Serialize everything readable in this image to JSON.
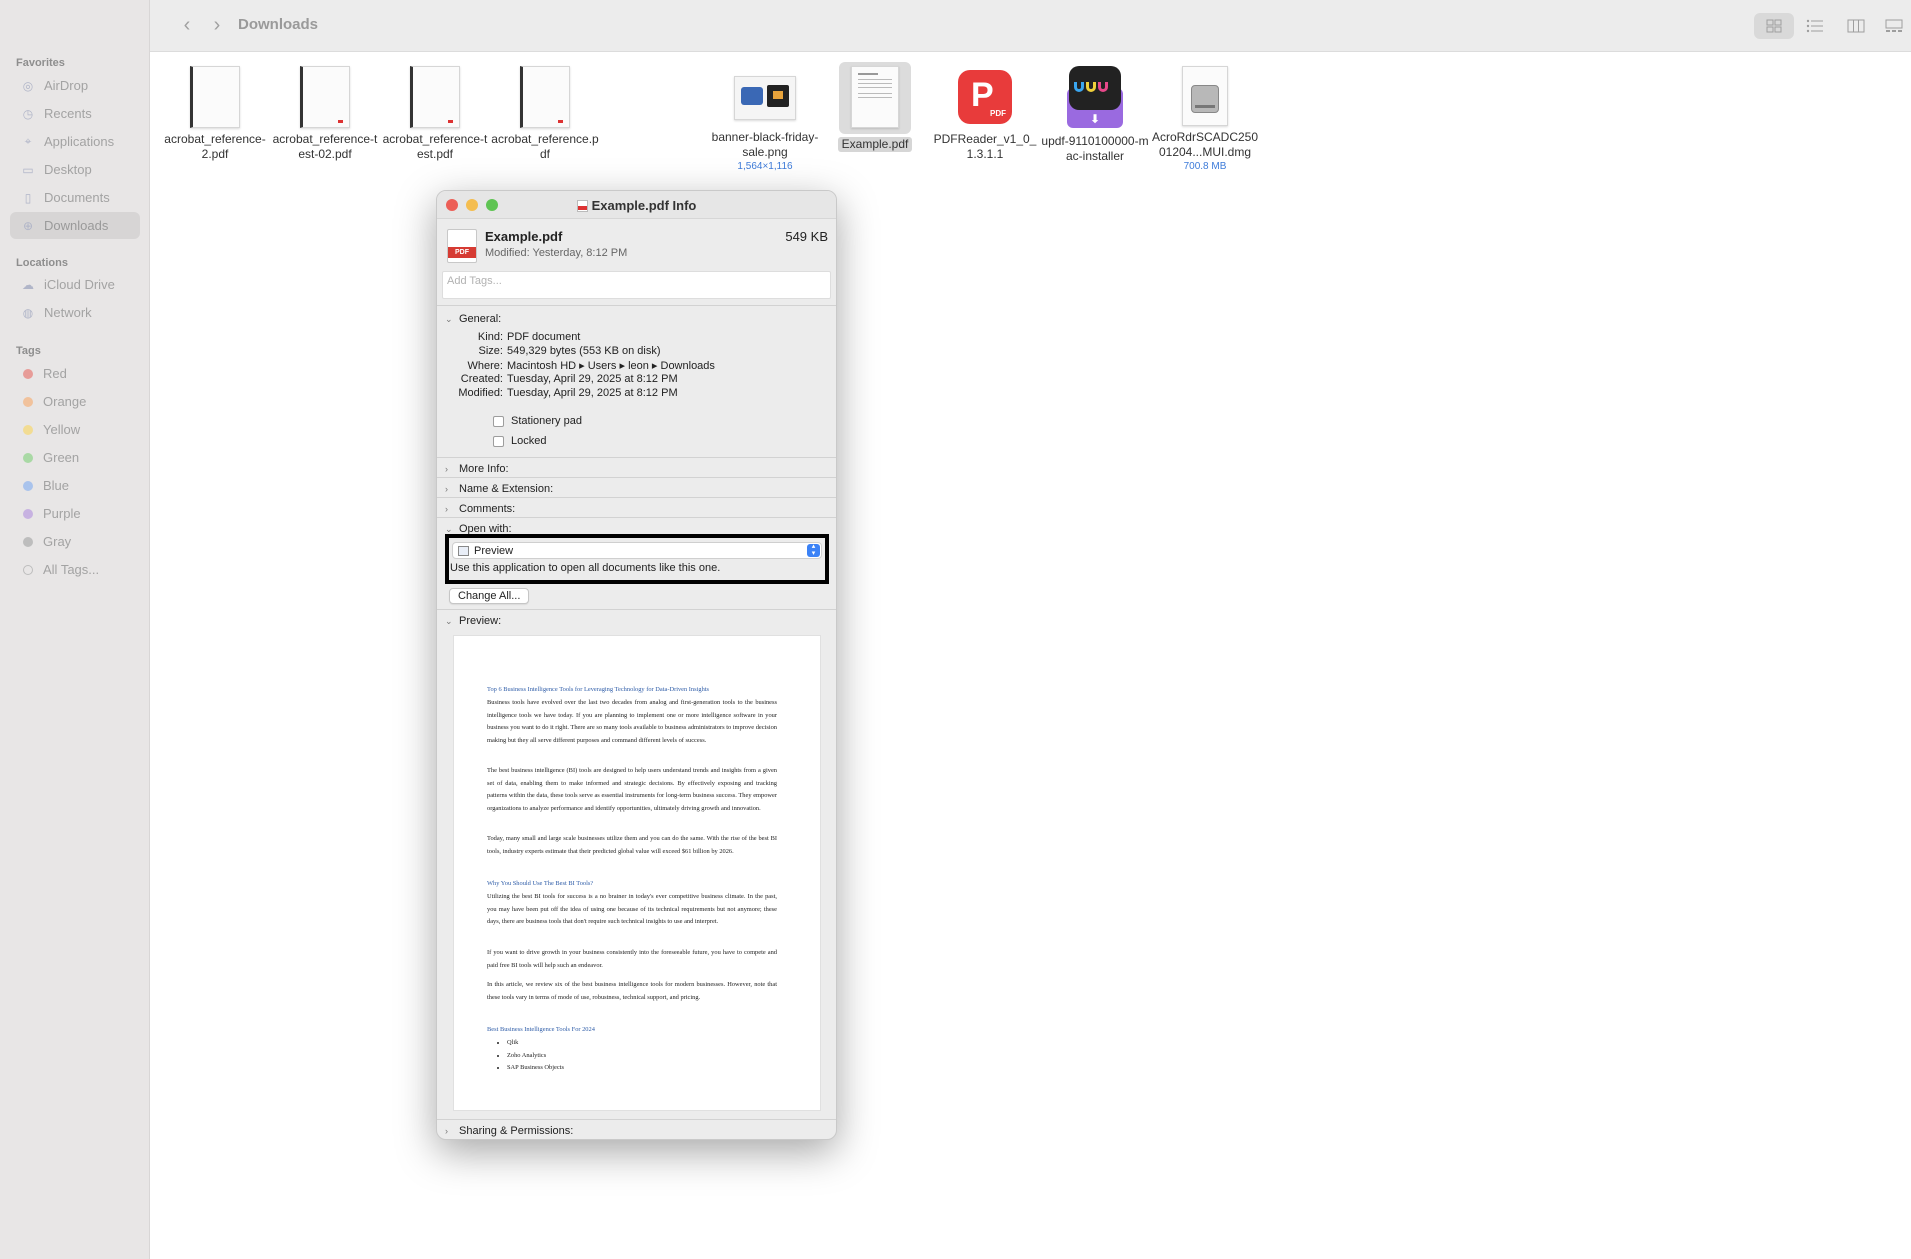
{
  "sidebar": {
    "favorites_label": "Favorites",
    "favorites": [
      {
        "label": "AirDrop",
        "icon": "airdrop-icon"
      },
      {
        "label": "Recents",
        "icon": "clock-icon"
      },
      {
        "label": "Applications",
        "icon": "applications-icon"
      },
      {
        "label": "Desktop",
        "icon": "desktop-icon"
      },
      {
        "label": "Documents",
        "icon": "document-icon"
      },
      {
        "label": "Downloads",
        "icon": "download-icon",
        "active": true
      }
    ],
    "locations_label": "Locations",
    "locations": [
      {
        "label": "iCloud Drive",
        "icon": "cloud-icon"
      },
      {
        "label": "Network",
        "icon": "globe-icon"
      }
    ],
    "tags_label": "Tags",
    "tags": [
      {
        "label": "Red",
        "color": "#e79c98"
      },
      {
        "label": "Orange",
        "color": "#f1c29c"
      },
      {
        "label": "Yellow",
        "color": "#f2dc93"
      },
      {
        "label": "Green",
        "color": "#a9d9a5"
      },
      {
        "label": "Blue",
        "color": "#a9c3ec"
      },
      {
        "label": "Purple",
        "color": "#c7b2e1"
      },
      {
        "label": "Gray",
        "color": "#bdbdbd"
      },
      {
        "label": "All Tags...",
        "color": "none"
      }
    ]
  },
  "toolbar": {
    "title": "Downloads",
    "back_icon": "chevron-left-icon",
    "forward_icon": "chevron-right-icon"
  },
  "files": [
    {
      "name": "acrobat_reference-2.pdf",
      "meta": ""
    },
    {
      "name": "acrobat_reference-test-02.pdf",
      "meta": ""
    },
    {
      "name": "acrobat_reference-test.pdf",
      "meta": ""
    },
    {
      "name": "acrobat_reference.pdf",
      "meta": ""
    },
    {
      "name": "banner-black-friday-sale.png",
      "meta": "1,564×1,116"
    },
    {
      "name": "Example.pdf",
      "meta": ""
    },
    {
      "name": "PDFReader_v1_0_1.3.1.1",
      "meta": ""
    },
    {
      "name": "updf-9110100000-mac-installer",
      "meta": ""
    },
    {
      "name": "AcroRdrSCADC25001204...MUI.dmg",
      "meta": "700.8 MB"
    }
  ],
  "info": {
    "window_title": "Example.pdf Info",
    "file_name": "Example.pdf",
    "file_size": "549 KB",
    "modified_short": "Modified: Yesterday, 8:12 PM",
    "tags_placeholder": "Add Tags...",
    "general_label": "General:",
    "general": [
      {
        "k": "Kind:",
        "v": "PDF document"
      },
      {
        "k": "Size:",
        "v": "549,329 bytes (553 KB on disk)"
      },
      {
        "k": "Where:",
        "v": "Macintosh HD ▸ Users ▸ leon ▸ Downloads"
      },
      {
        "k": "Created:",
        "v": "Tuesday, April 29, 2025 at 8:12 PM"
      },
      {
        "k": "Modified:",
        "v": "Tuesday, April 29, 2025 at 8:12 PM"
      }
    ],
    "stationery_label": "Stationery pad",
    "locked_label": "Locked",
    "more_info_label": "More Info:",
    "name_ext_label": "Name & Extension:",
    "comments_label": "Comments:",
    "open_with_label": "Open with:",
    "open_with_app": "Preview",
    "open_with_hint": "Use this application to open all documents like this one.",
    "change_all_label": "Change All...",
    "preview_label": "Preview:",
    "sharing_label": "Sharing & Permissions:"
  },
  "preview": {
    "title": "Top 6 Business Intelligence Tools for Leveraging Technology for Data-Driven Insights",
    "p1": "Business tools have evolved over the last two decades from analog and first-generation tools to the business intelligence tools we have today.  If you are planning to implement one or more intelligence software in your business you want to do it right. There are so many tools available to business administrators to improve decision making but they all serve different purposes and command different levels of success.",
    "p2": "The best business intelligence (BI) tools are designed to help users understand trends and insights from a given set of data, enabling them to make informed and strategic decisions. By effectively exposing and tracking patterns within the data, these tools serve as essential instruments for long-term business success. They empower organizations to analyze performance and identify opportunities, ultimately driving growth and innovation.",
    "p3": "Today, many small and large scale businesses utilize them and you can do the same. With the rise of the best BI tools, industry experts estimate that their predicted global value will exceed $61 billion by 2026.",
    "h2": "Why You Should Use The Best BI Tools?",
    "p4": "Utilizing the best BI tools for success is a no brainer in today's ever competitive business climate. In the past, you may have been put off the idea of using one because of its technical requirements but not anymore; these days, there are business tools that don't require such technical insights to use and interpret.",
    "p5": "If you want to drive growth in your business consistently into the foreseeable future, you have to compete and paid free BI tools will help such an endeavor.",
    "p6": "In this article, we review six of the best business intelligence tools for modern businesses. However, note that these tools vary in terms of mode of use, robustness, technical support, and pricing.",
    "h3": "Best Business Intelligence Tools For 2024",
    "list": [
      "Qlik",
      "Zoho Analytics",
      "SAP Business Objects"
    ]
  }
}
